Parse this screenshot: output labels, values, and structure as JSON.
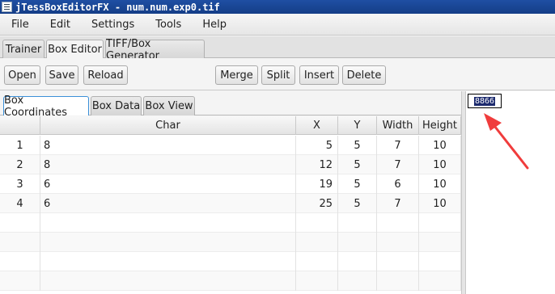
{
  "window": {
    "title": "jTessBoxEditorFX - num.num.exp0.tif"
  },
  "menu": [
    "File",
    "Edit",
    "Settings",
    "Tools",
    "Help"
  ],
  "main_tabs": [
    "Trainer",
    "Box Editor",
    "TIFF/Box Generator"
  ],
  "toolbar": {
    "open": "Open",
    "save": "Save",
    "reload": "Reload",
    "merge": "Merge",
    "split": "Split",
    "insert": "Insert",
    "delete": "Delete"
  },
  "sub_tabs": [
    "Box Coordinates",
    "Box Data",
    "Box View"
  ],
  "table": {
    "headers": [
      "",
      "Char",
      "X",
      "Y",
      "Width",
      "Height"
    ],
    "rows": [
      {
        "idx": "1",
        "char": "8",
        "x": "5",
        "y": "5",
        "w": "7",
        "h": "10"
      },
      {
        "idx": "2",
        "char": "8",
        "x": "12",
        "y": "5",
        "w": "7",
        "h": "10"
      },
      {
        "idx": "3",
        "char": "6",
        "x": "19",
        "y": "5",
        "w": "6",
        "h": "10"
      },
      {
        "idx": "4",
        "char": "6",
        "x": "25",
        "y": "5",
        "w": "7",
        "h": "10"
      }
    ]
  },
  "preview": {
    "text": "8866"
  },
  "colors": {
    "annotation_arrow": "#f03c3c",
    "title_bar": "#1f4fa3",
    "selected_tab_border": "#3a8fd8"
  }
}
